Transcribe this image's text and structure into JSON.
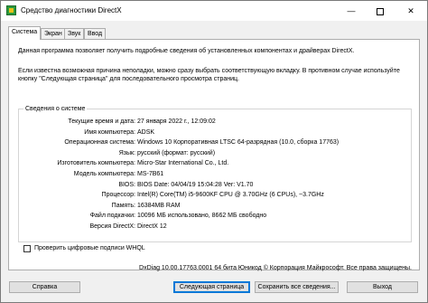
{
  "window": {
    "title": "Средство диагностики DirectX",
    "minimize_glyph": "—",
    "close_glyph": "✕"
  },
  "tabs": [
    {
      "label": "Система",
      "active": true
    },
    {
      "label": "Экран",
      "active": false
    },
    {
      "label": "Звук",
      "active": false
    },
    {
      "label": "Ввод",
      "active": false
    }
  ],
  "intro": {
    "line1": "Данная программа позволяет получить подробные сведения об установленных компонентах и драйверах DirectX.",
    "line2": "Если известна возможная причина неполадки, можно сразу выбрать соответствующую вкладку. В противном случае используйте кнопку \"Следующая страница\" для последовательного просмотра страниц."
  },
  "system_info": {
    "group_title": "Сведения о системе",
    "rows": [
      {
        "label": "Текущие время и дата:",
        "value": "27 января 2022 г., 12:09:02"
      },
      {
        "label": "Имя компьютера:",
        "value": "ADSK"
      },
      {
        "label": "Операционная система:",
        "value": "Windows 10 Корпоративная LTSC 64-разрядная (10.0, сборка 17763)"
      },
      {
        "label": "Язык:",
        "value": "русский (формат: русский)"
      },
      {
        "label": "Изготовитель компьютера:",
        "value": "Micro-Star International Co., Ltd."
      },
      {
        "label": "Модель компьютера:",
        "value": "MS-7B61"
      },
      {
        "label": "BIOS:",
        "value": "BIOS Date: 04/04/19 15:04:28 Ver: V1.70"
      },
      {
        "label": "Процессор:",
        "value": "Intel(R) Core(TM) i5-9600KF CPU @ 3.70GHz (6 CPUs), ~3.7GHz"
      },
      {
        "label": "Память:",
        "value": "16384MB RAM"
      },
      {
        "label": "Файл подкачки:",
        "value": "10096 МБ использовано, 8662 МБ свободно"
      },
      {
        "label": "Версия DirectX:",
        "value": "DirectX 12"
      }
    ]
  },
  "whql_checkbox": {
    "label": "Проверить цифровые подписи WHQL",
    "checked": false
  },
  "copyright": "DxDiag 10.00.17763.0001 64 бита Юникод  © Корпорация Майкрософт. Все права защищены.",
  "buttons": {
    "help": "Справка",
    "next": "Следующая страница",
    "save": "Сохранить все сведения...",
    "exit": "Выход"
  },
  "colors": {
    "window_bg": "#f0f0f0",
    "panel_bg": "#ffffff",
    "default_button_border": "#0078d7"
  }
}
